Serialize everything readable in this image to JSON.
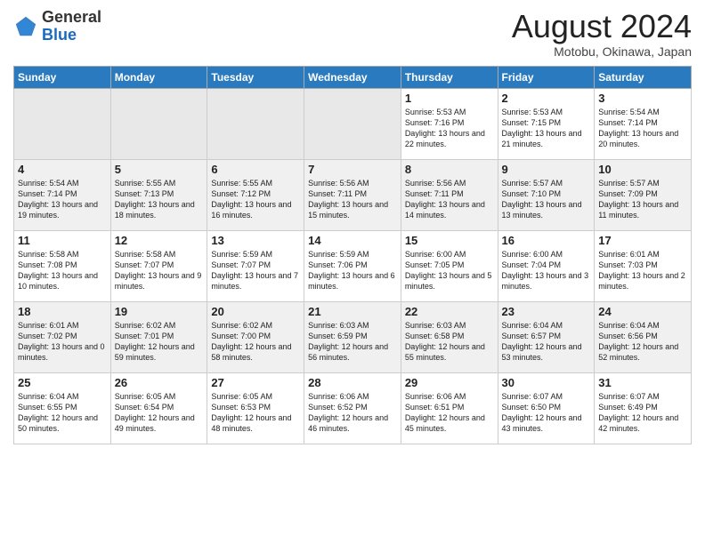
{
  "header": {
    "logo_general": "General",
    "logo_blue": "Blue",
    "month": "August 2024",
    "location": "Motobu, Okinawa, Japan"
  },
  "days_of_week": [
    "Sunday",
    "Monday",
    "Tuesday",
    "Wednesday",
    "Thursday",
    "Friday",
    "Saturday"
  ],
  "weeks": [
    [
      {
        "day": "",
        "content": ""
      },
      {
        "day": "",
        "content": ""
      },
      {
        "day": "",
        "content": ""
      },
      {
        "day": "",
        "content": ""
      },
      {
        "day": "1",
        "content": "Sunrise: 5:53 AM\nSunset: 7:16 PM\nDaylight: 13 hours\nand 22 minutes."
      },
      {
        "day": "2",
        "content": "Sunrise: 5:53 AM\nSunset: 7:15 PM\nDaylight: 13 hours\nand 21 minutes."
      },
      {
        "day": "3",
        "content": "Sunrise: 5:54 AM\nSunset: 7:14 PM\nDaylight: 13 hours\nand 20 minutes."
      }
    ],
    [
      {
        "day": "4",
        "content": "Sunrise: 5:54 AM\nSunset: 7:14 PM\nDaylight: 13 hours\nand 19 minutes."
      },
      {
        "day": "5",
        "content": "Sunrise: 5:55 AM\nSunset: 7:13 PM\nDaylight: 13 hours\nand 18 minutes."
      },
      {
        "day": "6",
        "content": "Sunrise: 5:55 AM\nSunset: 7:12 PM\nDaylight: 13 hours\nand 16 minutes."
      },
      {
        "day": "7",
        "content": "Sunrise: 5:56 AM\nSunset: 7:11 PM\nDaylight: 13 hours\nand 15 minutes."
      },
      {
        "day": "8",
        "content": "Sunrise: 5:56 AM\nSunset: 7:11 PM\nDaylight: 13 hours\nand 14 minutes."
      },
      {
        "day": "9",
        "content": "Sunrise: 5:57 AM\nSunset: 7:10 PM\nDaylight: 13 hours\nand 13 minutes."
      },
      {
        "day": "10",
        "content": "Sunrise: 5:57 AM\nSunset: 7:09 PM\nDaylight: 13 hours\nand 11 minutes."
      }
    ],
    [
      {
        "day": "11",
        "content": "Sunrise: 5:58 AM\nSunset: 7:08 PM\nDaylight: 13 hours\nand 10 minutes."
      },
      {
        "day": "12",
        "content": "Sunrise: 5:58 AM\nSunset: 7:07 PM\nDaylight: 13 hours\nand 9 minutes."
      },
      {
        "day": "13",
        "content": "Sunrise: 5:59 AM\nSunset: 7:07 PM\nDaylight: 13 hours\nand 7 minutes."
      },
      {
        "day": "14",
        "content": "Sunrise: 5:59 AM\nSunset: 7:06 PM\nDaylight: 13 hours\nand 6 minutes."
      },
      {
        "day": "15",
        "content": "Sunrise: 6:00 AM\nSunset: 7:05 PM\nDaylight: 13 hours\nand 5 minutes."
      },
      {
        "day": "16",
        "content": "Sunrise: 6:00 AM\nSunset: 7:04 PM\nDaylight: 13 hours\nand 3 minutes."
      },
      {
        "day": "17",
        "content": "Sunrise: 6:01 AM\nSunset: 7:03 PM\nDaylight: 13 hours\nand 2 minutes."
      }
    ],
    [
      {
        "day": "18",
        "content": "Sunrise: 6:01 AM\nSunset: 7:02 PM\nDaylight: 13 hours\nand 0 minutes."
      },
      {
        "day": "19",
        "content": "Sunrise: 6:02 AM\nSunset: 7:01 PM\nDaylight: 12 hours\nand 59 minutes."
      },
      {
        "day": "20",
        "content": "Sunrise: 6:02 AM\nSunset: 7:00 PM\nDaylight: 12 hours\nand 58 minutes."
      },
      {
        "day": "21",
        "content": "Sunrise: 6:03 AM\nSunset: 6:59 PM\nDaylight: 12 hours\nand 56 minutes."
      },
      {
        "day": "22",
        "content": "Sunrise: 6:03 AM\nSunset: 6:58 PM\nDaylight: 12 hours\nand 55 minutes."
      },
      {
        "day": "23",
        "content": "Sunrise: 6:04 AM\nSunset: 6:57 PM\nDaylight: 12 hours\nand 53 minutes."
      },
      {
        "day": "24",
        "content": "Sunrise: 6:04 AM\nSunset: 6:56 PM\nDaylight: 12 hours\nand 52 minutes."
      }
    ],
    [
      {
        "day": "25",
        "content": "Sunrise: 6:04 AM\nSunset: 6:55 PM\nDaylight: 12 hours\nand 50 minutes."
      },
      {
        "day": "26",
        "content": "Sunrise: 6:05 AM\nSunset: 6:54 PM\nDaylight: 12 hours\nand 49 minutes."
      },
      {
        "day": "27",
        "content": "Sunrise: 6:05 AM\nSunset: 6:53 PM\nDaylight: 12 hours\nand 48 minutes."
      },
      {
        "day": "28",
        "content": "Sunrise: 6:06 AM\nSunset: 6:52 PM\nDaylight: 12 hours\nand 46 minutes."
      },
      {
        "day": "29",
        "content": "Sunrise: 6:06 AM\nSunset: 6:51 PM\nDaylight: 12 hours\nand 45 minutes."
      },
      {
        "day": "30",
        "content": "Sunrise: 6:07 AM\nSunset: 6:50 PM\nDaylight: 12 hours\nand 43 minutes."
      },
      {
        "day": "31",
        "content": "Sunrise: 6:07 AM\nSunset: 6:49 PM\nDaylight: 12 hours\nand 42 minutes."
      }
    ]
  ]
}
